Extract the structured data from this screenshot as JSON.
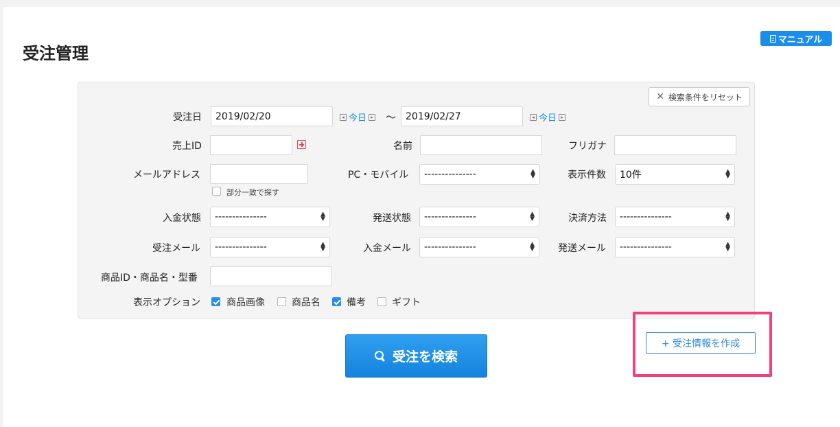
{
  "header": {
    "title": "受注管理",
    "manual_label": "マニュアル"
  },
  "search": {
    "reset_label": "検索条件をリセット",
    "order_date": {
      "label": "受注日",
      "from": "2019/02/20",
      "to": "2019/02/27",
      "today_label": "今日",
      "separator": "〜"
    },
    "sale_id": {
      "label": "売上ID",
      "value": ""
    },
    "name": {
      "label": "名前",
      "value": ""
    },
    "furigana": {
      "label": "フリガナ",
      "value": ""
    },
    "email": {
      "label": "メールアドレス",
      "value": "",
      "partial_match_label": "部分一致で探す"
    },
    "device": {
      "label": "PC・モバイル",
      "value": "---------------"
    },
    "display_count": {
      "label": "表示件数",
      "value": "10件"
    },
    "payment_status": {
      "label": "入金状態",
      "value": "---------------"
    },
    "shipping_status": {
      "label": "発送状態",
      "value": "---------------"
    },
    "payment_method": {
      "label": "決済方法",
      "value": "---------------"
    },
    "order_mail": {
      "label": "受注メール",
      "value": "---------------"
    },
    "payment_mail": {
      "label": "入金メール",
      "value": "---------------"
    },
    "shipping_mail": {
      "label": "発送メール",
      "value": "---------------"
    },
    "product": {
      "label": "商品ID・商品名・型番",
      "value": ""
    },
    "display_options": {
      "label": "表示オプション",
      "options": [
        {
          "label": "商品画像",
          "checked": true
        },
        {
          "label": "商品名",
          "checked": false
        },
        {
          "label": "備考",
          "checked": true
        },
        {
          "label": "ギフト",
          "checked": false
        }
      ]
    }
  },
  "actions": {
    "search_label": "受注を検索",
    "create_label": "+ 受注情報を作成"
  }
}
